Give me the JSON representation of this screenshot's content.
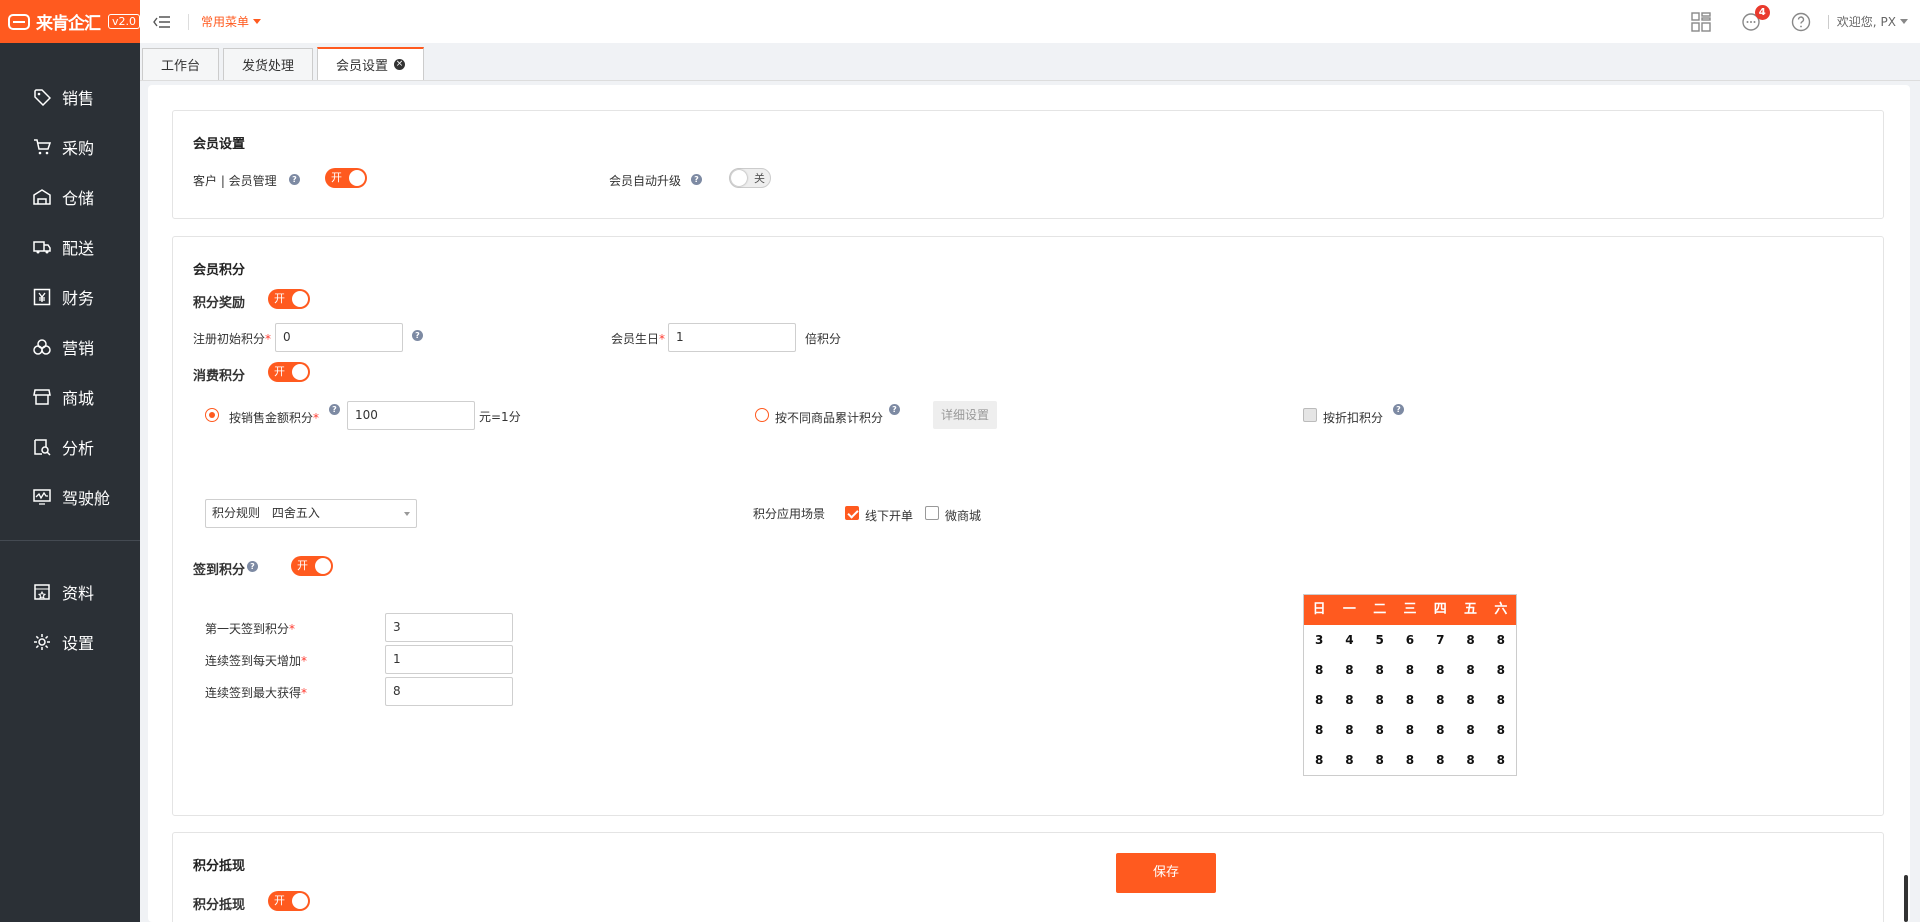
{
  "app": {
    "logo_text": "来肯企汇",
    "version": "v2.0"
  },
  "sidebar": {
    "items": [
      {
        "label": "销售",
        "icon": "tag-icon"
      },
      {
        "label": "采购",
        "icon": "cart-icon"
      },
      {
        "label": "仓储",
        "icon": "warehouse-icon"
      },
      {
        "label": "配送",
        "icon": "truck-icon"
      },
      {
        "label": "财务",
        "icon": "yen-icon"
      },
      {
        "label": "营销",
        "icon": "marketing-icon"
      },
      {
        "label": "商城",
        "icon": "store-icon"
      },
      {
        "label": "分析",
        "icon": "analysis-icon"
      },
      {
        "label": "驾驶舱",
        "icon": "dashboard-icon"
      }
    ],
    "bottom_items": [
      {
        "label": "资料",
        "icon": "data-icon"
      },
      {
        "label": "设置",
        "icon": "gear-icon"
      }
    ]
  },
  "topbar": {
    "common_menu": "常用菜单",
    "notification_count": "4",
    "welcome": "欢迎您,",
    "user": "PX"
  },
  "tabs": [
    {
      "label": "工作台",
      "active": false
    },
    {
      "label": "发货处理",
      "active": false
    },
    {
      "label": "会员设置",
      "active": true
    }
  ],
  "member_settings": {
    "title": "会员设置",
    "customer_member_label": "客户 | 会员管理",
    "customer_member_switch": "开",
    "auto_upgrade_label": "会员自动升级",
    "auto_upgrade_switch": "关"
  },
  "member_points": {
    "title": "会员积分",
    "reward_label": "积分奖励",
    "reward_switch": "开",
    "register_label": "注册初始积分",
    "register_value": "0",
    "birthday_label": "会员生日",
    "birthday_value": "1",
    "birthday_suffix": "倍积分",
    "consume_label": "消费积分",
    "consume_switch": "开",
    "by_amount_label": "按销售金额积分",
    "by_amount_value": "100",
    "by_amount_suffix": "元=1分",
    "by_product_label": "按不同商品累计积分",
    "detail_button": "详细设置",
    "by_discount_label": "按折扣积分",
    "rule_label": "积分规则",
    "rule_value": "四舍五入",
    "scene_label": "积分应用场景",
    "scene_offline": "线下开单",
    "scene_wechat": "微商城",
    "signin_label": "签到积分",
    "signin_switch": "开",
    "first_day_label": "第一天签到积分",
    "first_day_value": "3",
    "daily_increase_label": "连续签到每天增加",
    "daily_increase_value": "1",
    "max_label": "连续签到最大获得",
    "max_value": "8",
    "calendar": {
      "weekdays": [
        "日",
        "一",
        "二",
        "三",
        "四",
        "五",
        "六"
      ],
      "rows": [
        [
          "3",
          "4",
          "5",
          "6",
          "7",
          "8",
          "8"
        ],
        [
          "8",
          "8",
          "8",
          "8",
          "8",
          "8",
          "8"
        ],
        [
          "8",
          "8",
          "8",
          "8",
          "8",
          "8",
          "8"
        ],
        [
          "8",
          "8",
          "8",
          "8",
          "8",
          "8",
          "8"
        ],
        [
          "8",
          "8",
          "8",
          "8",
          "8",
          "8",
          "8"
        ]
      ]
    }
  },
  "points_offset": {
    "title": "积分抵现",
    "label": "积分抵现",
    "switch": "开"
  },
  "save_button": "保存",
  "colors": {
    "brand": "#ff5a1f",
    "sidebar_bg": "#2b3036"
  }
}
